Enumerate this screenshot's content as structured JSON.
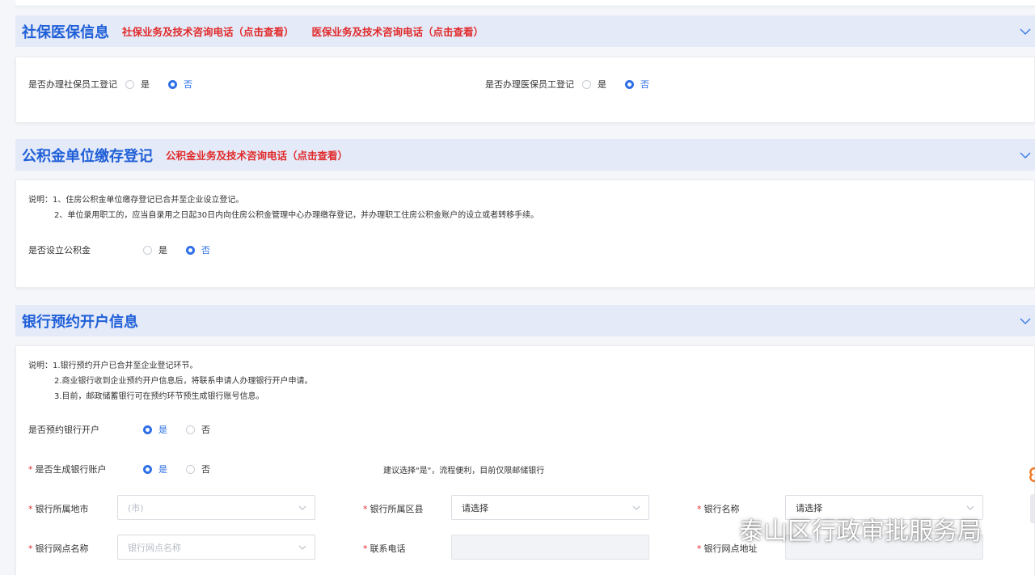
{
  "sections": {
    "social": {
      "title": "社保医保信息",
      "link1": "社保业务及技术咨询电话（点击查看）",
      "link2": "医保业务及技术咨询电话（点击查看）",
      "q1": {
        "label": "是否办理社保员工登记",
        "yes": "是",
        "no": "否"
      },
      "q2": {
        "label": "是否办理医保员工登记",
        "yes": "是",
        "no": "否"
      }
    },
    "fund": {
      "title": "公积金单位缴存登记",
      "link1": "公积金业务及技术咨询电话（点击查看）",
      "note1": "说明：1、住房公积金单位缴存登记已合并至企业设立登记。",
      "note2": "2、单位录用职工的，应当自录用之日起30日内向住房公积金管理中心办理缴存登记，并办理职工住房公积金账户的设立或者转移手续。",
      "q1": {
        "label": "是否设立公积金",
        "yes": "是",
        "no": "否"
      }
    },
    "bank": {
      "title": "银行预约开户信息",
      "note1": "说明：1.银行预约开户已合并至企业登记环节。",
      "note2": "2.商业银行收到企业预约开户信息后，将联系申请人办理银行开户申请。",
      "note3": "3.目前，邮政储蓄银行可在预约环节预生成银行账号信息。",
      "q1": {
        "label": "是否预约银行开户",
        "yes": "是",
        "no": "否"
      },
      "q2": {
        "label": "是否生成银行账户",
        "yes": "是",
        "no": "否",
        "hint": "建议选择\"是\"，流程便利，目前仅限邮储银行"
      },
      "city": {
        "label": "银行所属地市",
        "value": "(市)"
      },
      "district": {
        "label": "银行所属区县",
        "value": "请选择"
      },
      "bankname": {
        "label": "银行名称",
        "value": "请选择"
      },
      "branch": {
        "label": "银行网点名称",
        "value": "银行网点名称"
      },
      "phone": {
        "label": "联系电话"
      },
      "address": {
        "label": "银行网点地址"
      },
      "required_mark": "*"
    }
  },
  "watermark": "泰山区行政审批服务局",
  "colors": {
    "accent": "#2e6fe6",
    "title": "#1f5fd8",
    "link": "#e12a2a",
    "header_bg": "#e4eaf8"
  }
}
